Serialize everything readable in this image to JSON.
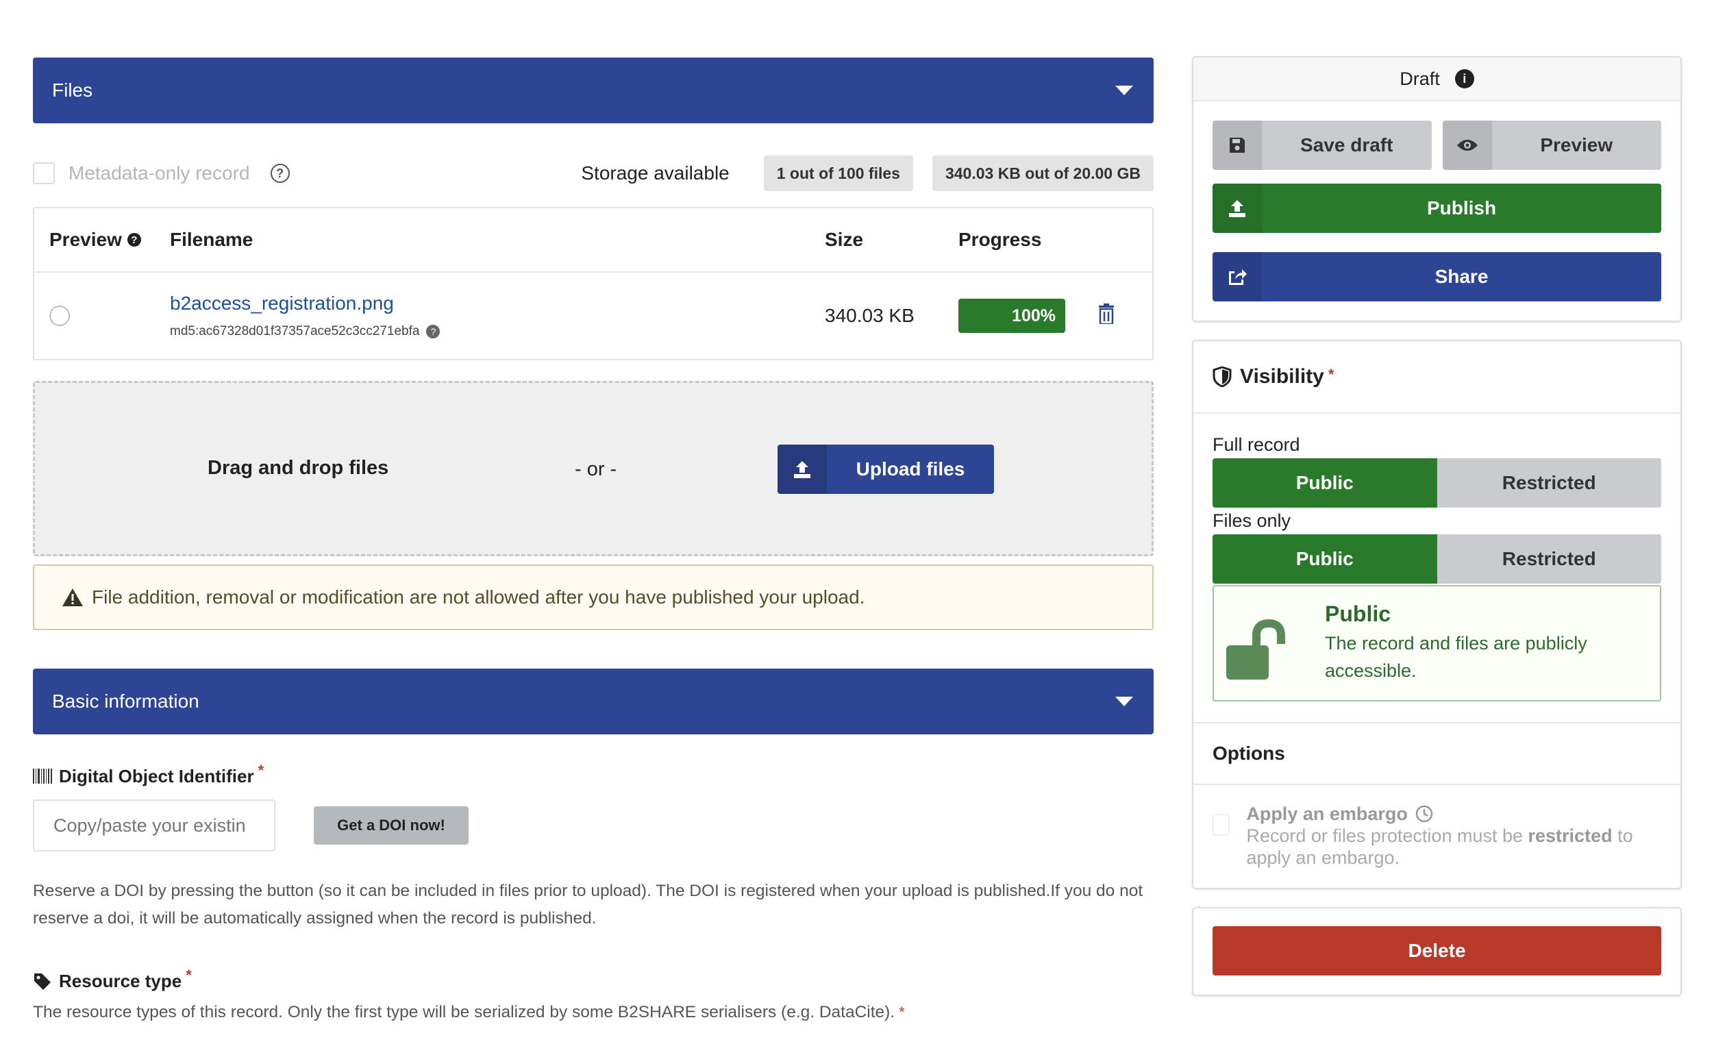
{
  "files_section": {
    "header": "Files",
    "metadata_only_label": "Metadata-only record",
    "storage_label": "Storage available",
    "files_pill": "1 out of 100 files",
    "size_pill": "340.03 KB out of 20.00 GB",
    "table": {
      "headers": {
        "preview": "Preview",
        "filename": "Filename",
        "size": "Size",
        "progress": "Progress"
      },
      "rows": [
        {
          "filename": "b2access_registration.png",
          "checksum": "md5:ac67328d01f37357ace52c3cc271ebfa",
          "size": "340.03 KB",
          "progress": "100%"
        }
      ]
    },
    "dropzone": {
      "text": "Drag and drop files",
      "or": "- or -",
      "upload_label": "Upload files"
    },
    "warning": "File addition, removal or modification are not allowed after you have published your upload."
  },
  "basic_section": {
    "header": "Basic information",
    "doi": {
      "title": "Digital Object Identifier",
      "required_mark": "*",
      "placeholder": "Copy/paste your existin",
      "button": "Get a DOI now!",
      "help": "Reserve a DOI by pressing the button (so it can be included in files prior to upload). The DOI is registered when your upload is published.If you do not reserve a doi, it will be automatically assigned when the record is published."
    },
    "resource_type": {
      "title": "Resource type",
      "required_mark": "*",
      "help": "The resource types of this record. Only the first type will be serialized by some B2SHARE serialisers (e.g. DataCite).",
      "help_required_mark": "*"
    }
  },
  "actions_card": {
    "status": "Draft",
    "save_draft": "Save draft",
    "preview": "Preview",
    "publish": "Publish",
    "share": "Share"
  },
  "visibility_card": {
    "title": "Visibility",
    "required_mark": "*",
    "full_record_label": "Full record",
    "files_only_label": "Files only",
    "public_label": "Public",
    "restricted_label": "Restricted",
    "info_title": "Public",
    "info_desc": "The record and files are publicly accessible.",
    "options_title": "Options",
    "embargo_title": "Apply an embargo",
    "embargo_desc_pre": "Record or files protection must be ",
    "embargo_desc_bold": "restricted",
    "embargo_desc_post": " to apply an embargo."
  },
  "delete_card": {
    "delete": "Delete"
  },
  "colors": {
    "primary_blue": "#2e4595",
    "success_green": "#2a7a2c",
    "danger_red": "#b8392a",
    "neutral_grey": "#c9cbce"
  }
}
